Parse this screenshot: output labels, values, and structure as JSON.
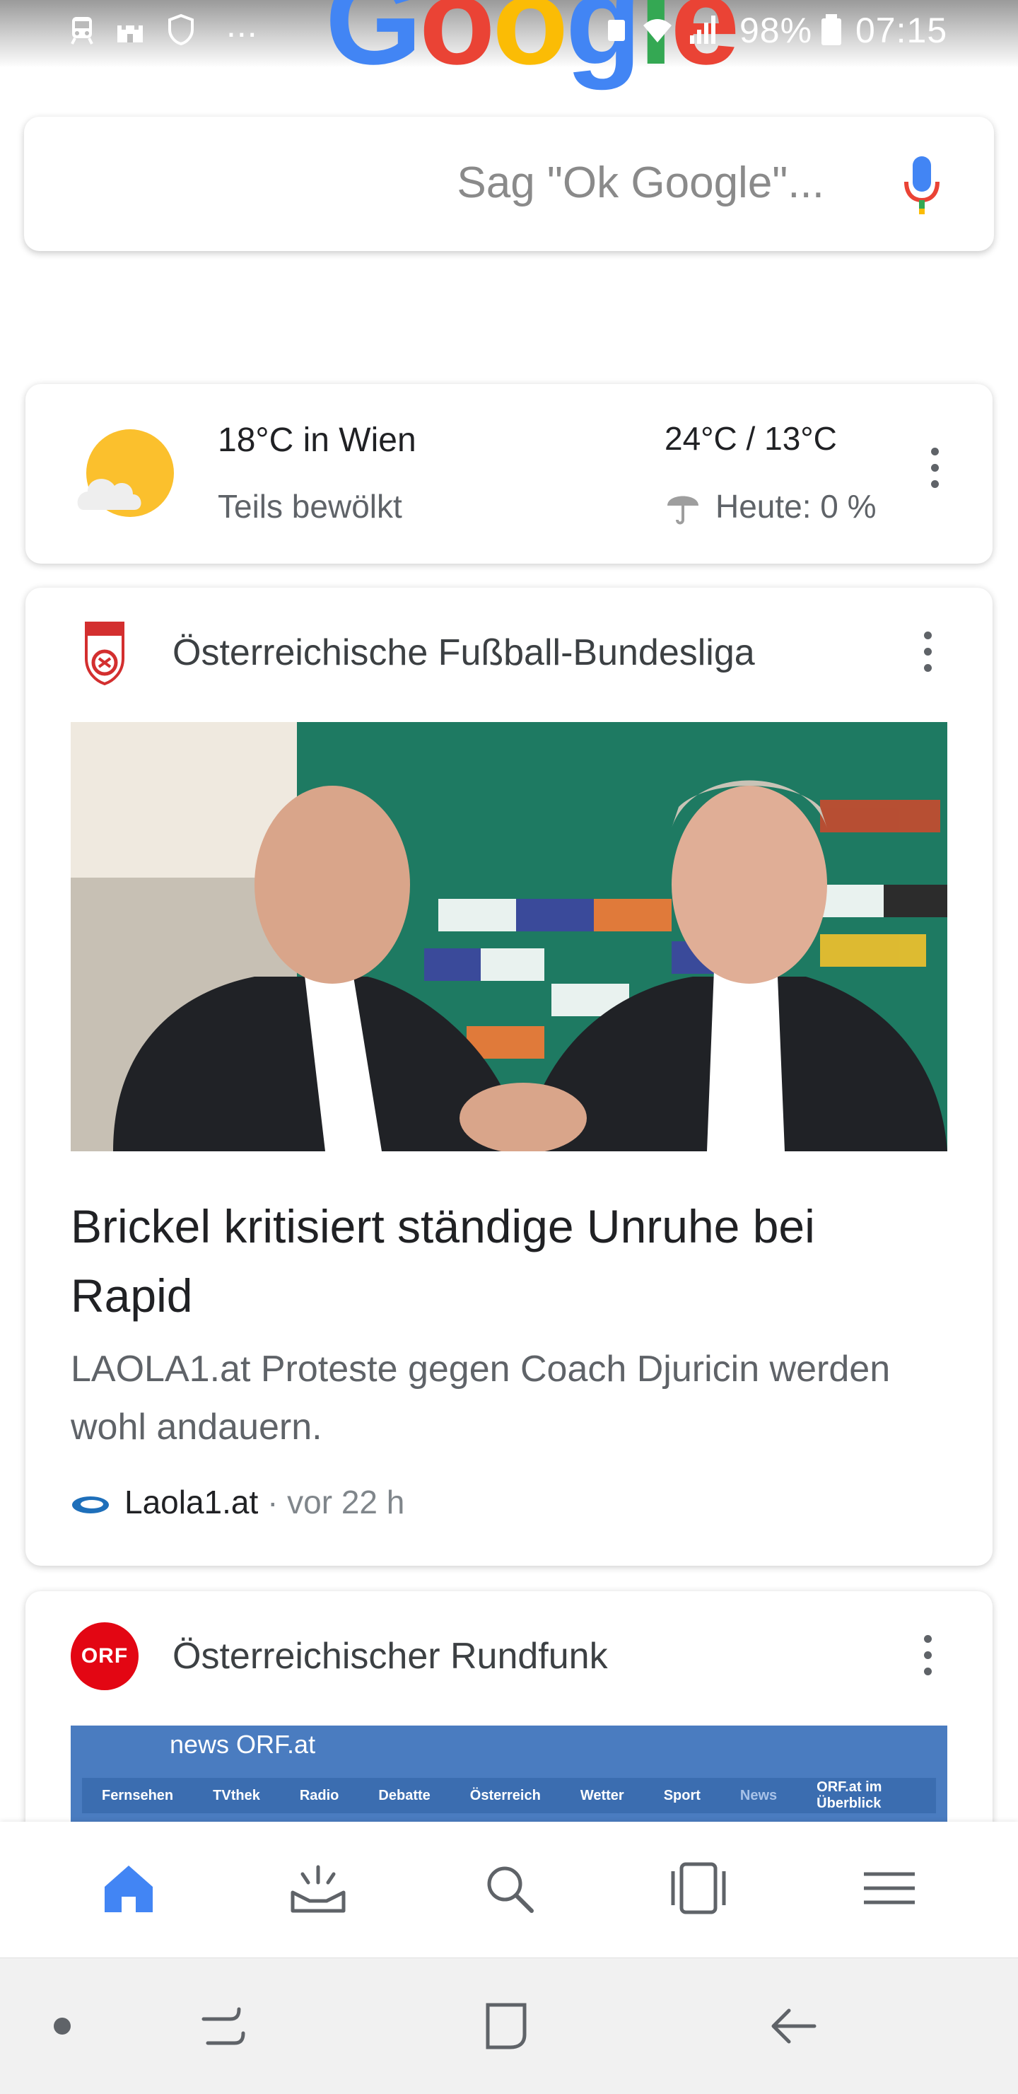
{
  "status_bar": {
    "battery": "98%",
    "time": "07:15",
    "overflow": "..."
  },
  "google_logo": "Google",
  "search": {
    "placeholder": "Sag \"Ok Google\"..."
  },
  "weather": {
    "temp_location": "18°C in Wien",
    "condition": "Teils bewölkt",
    "range": "24°C / 13°C",
    "precip": "Heute: 0 %"
  },
  "news": [
    {
      "source": "Österreichische Fußball-Bundesliga",
      "headline": "Brickel kritisiert ständige Unruhe bei Rapid",
      "snippet": "LAOLA1.at Proteste gegen Coach Djuricin werden wohl andauern.",
      "publisher": "Laola1.at",
      "time": "· vor 22 h"
    },
    {
      "source": "Österreichischer Rundfunk",
      "logo_text": "ORF",
      "image_header": "news ORF.at",
      "image_nav": [
        "Fernsehen",
        "TVthek",
        "Radio",
        "Debatte",
        "Österreich",
        "Wetter",
        "Sport",
        "News",
        "ORF.at im Überblick"
      ]
    }
  ],
  "colors": {
    "google_blue": "#4285f4",
    "google_red": "#ea4335",
    "google_yellow": "#fbbc05",
    "google_green": "#34a853",
    "orf_red": "#e30613"
  },
  "bottom_nav": [
    "home-icon",
    "updates-icon",
    "search-icon",
    "recents-icon",
    "menu-icon"
  ],
  "system_nav": [
    "dot-icon",
    "recent-apps-icon",
    "home-square-icon",
    "back-icon"
  ]
}
